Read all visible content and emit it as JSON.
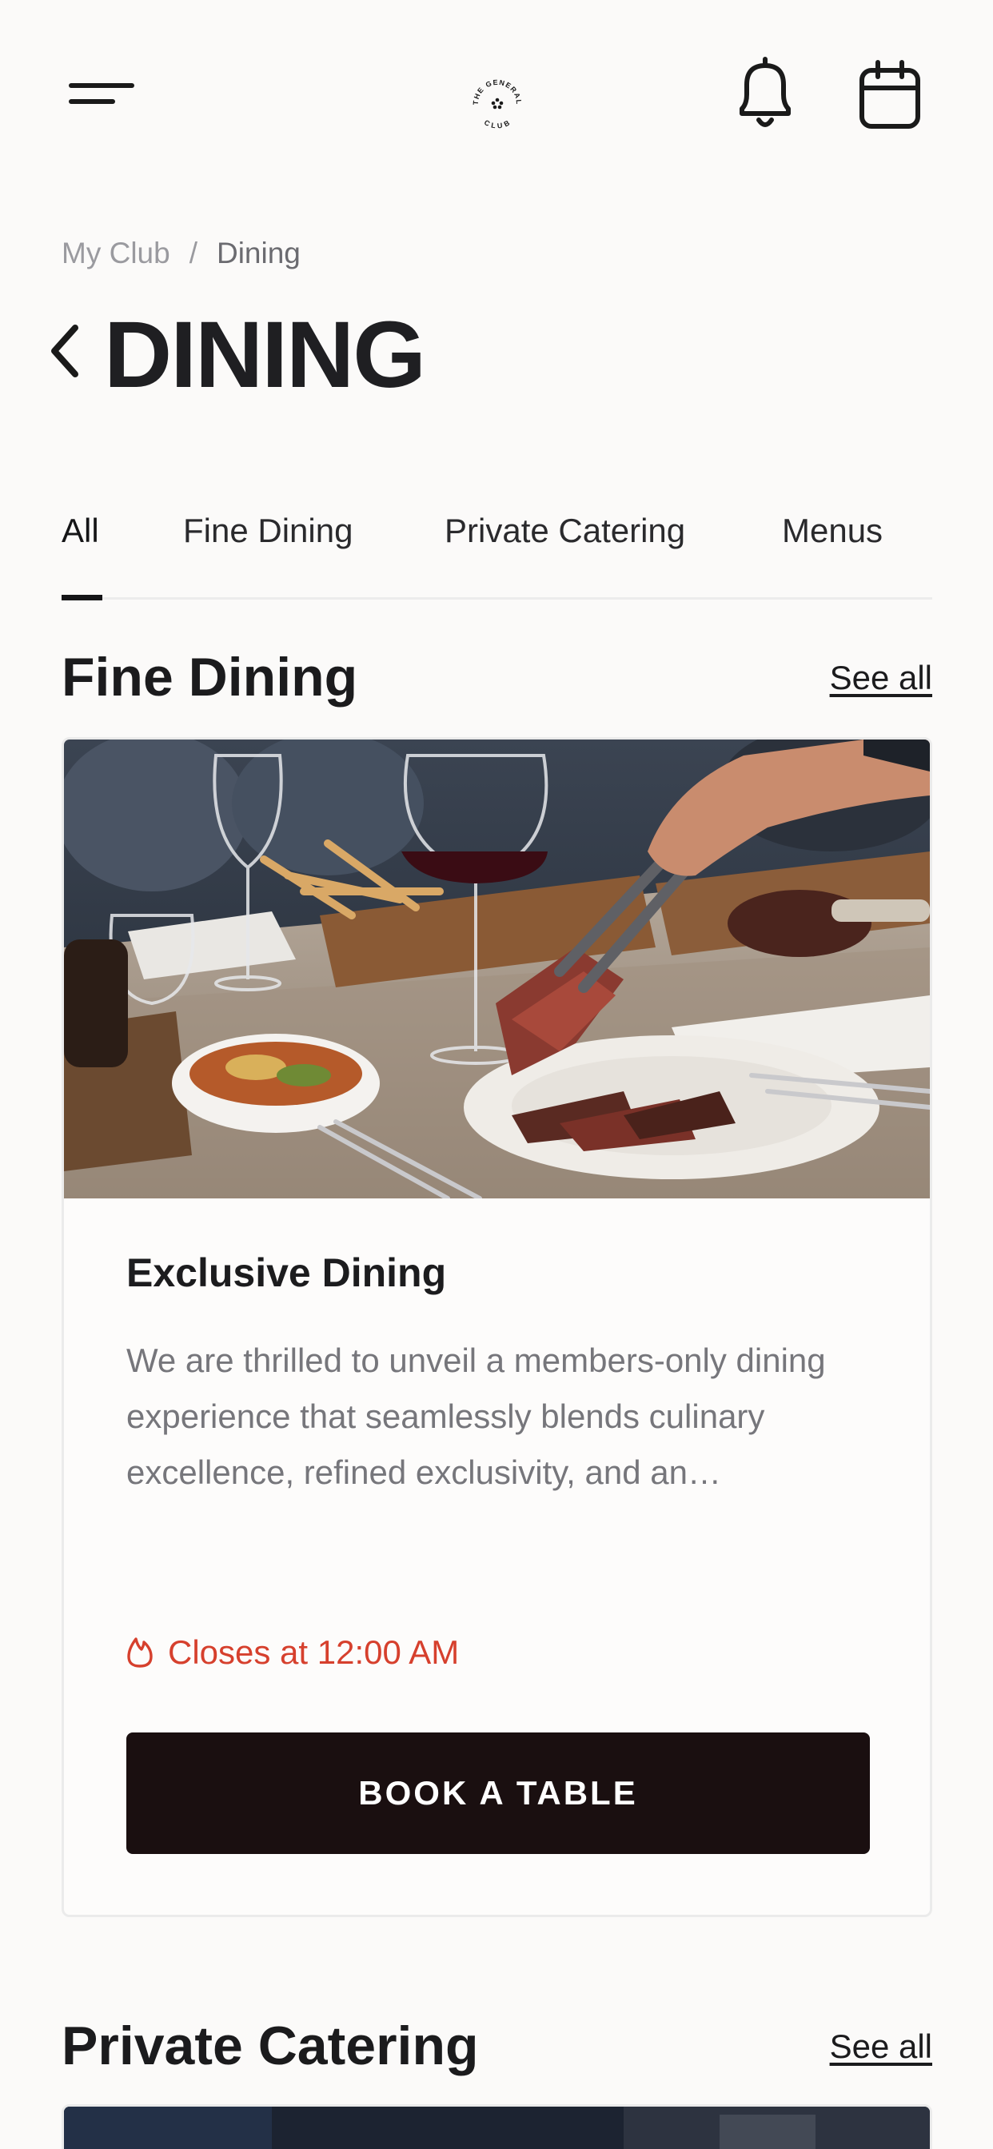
{
  "header": {
    "menu_icon": "hamburger-menu-icon",
    "logo_text_top": "THE GENERAL",
    "logo_text_bottom": "CLUB",
    "notification_icon": "bell-icon",
    "calendar_icon": "calendar-icon"
  },
  "breadcrumb": {
    "items": [
      "My Club",
      "Dining"
    ],
    "separator": "/"
  },
  "page": {
    "back_icon": "chevron-left-icon",
    "title": "DINING"
  },
  "tabs": [
    {
      "label": "All",
      "active": true
    },
    {
      "label": "Fine Dining",
      "active": false
    },
    {
      "label": "Private Catering",
      "active": false
    },
    {
      "label": "Menus",
      "active": false
    }
  ],
  "sections": [
    {
      "title": "Fine Dining",
      "see_all": "See all",
      "card": {
        "title": "Exclusive Dining",
        "description": "We are thrilled to unveil a members-only dining experience that seamlessly blends culinary excellence, refined exclusivity, and an…",
        "status_icon": "flame-icon",
        "status": "Closes at 12:00 AM",
        "button": "BOOK A TABLE"
      }
    },
    {
      "title": "Private Catering",
      "see_all": "See all"
    }
  ],
  "colors": {
    "background": "#fbfaf9",
    "status_red": "#d6402d",
    "button_bg": "#1a0f10",
    "muted_text": "#76767b"
  }
}
